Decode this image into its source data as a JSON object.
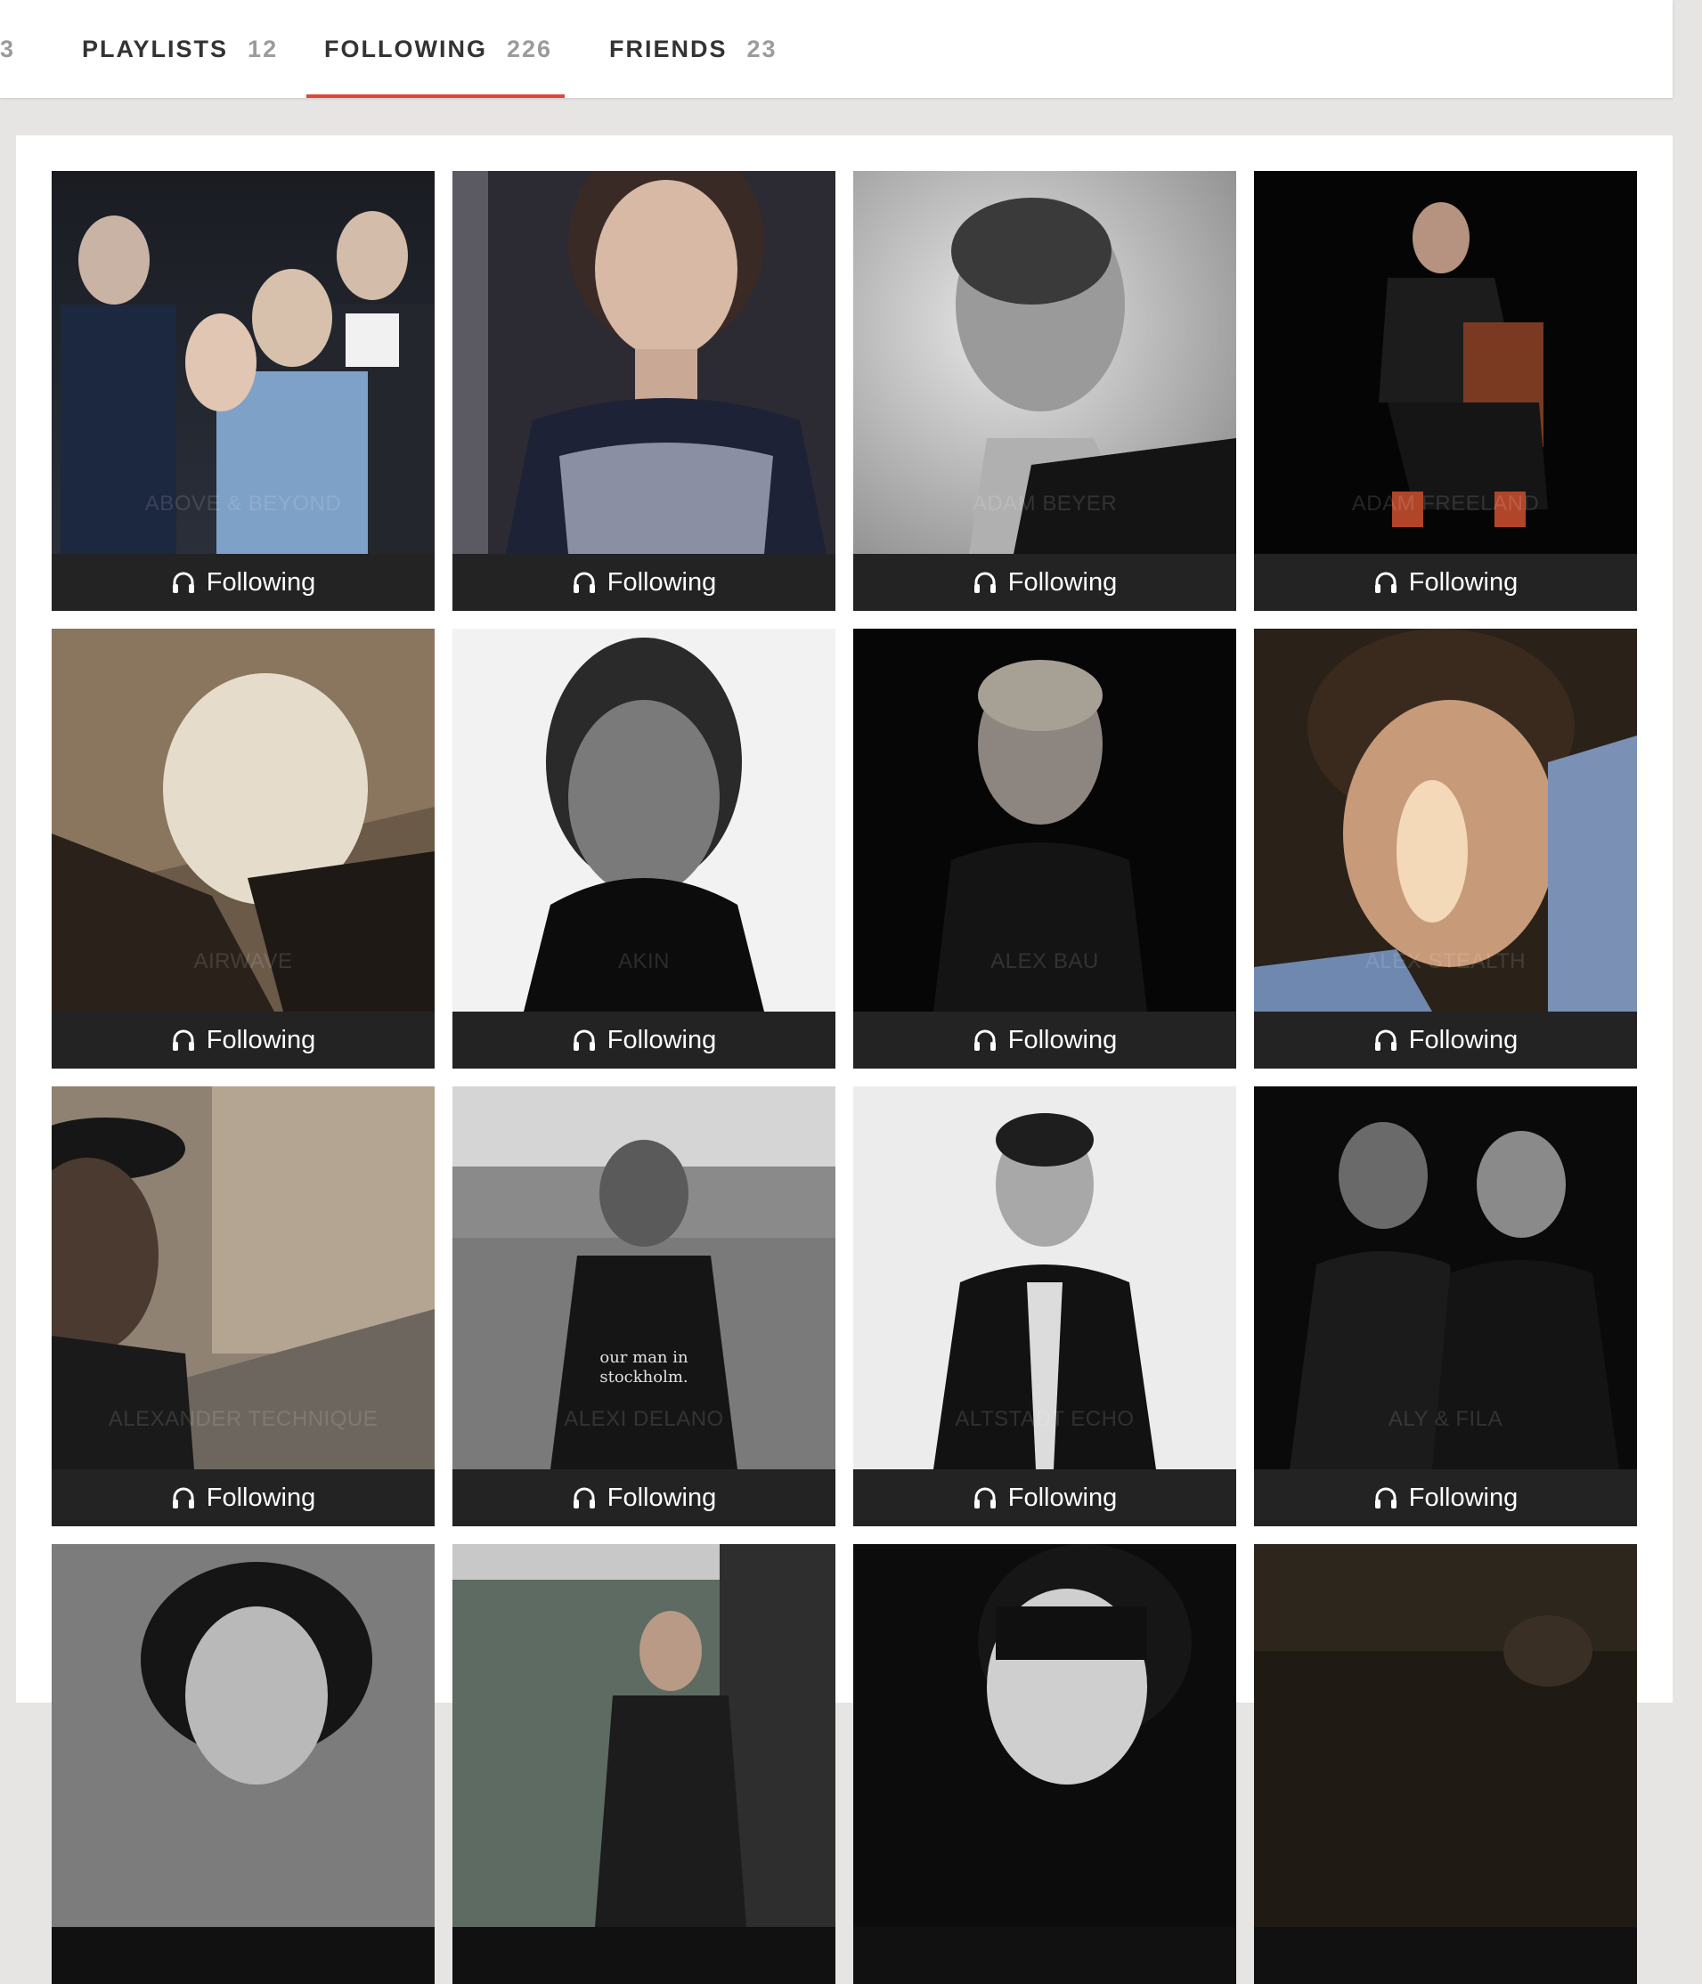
{
  "tabs": [
    {
      "label": "",
      "count": "3"
    },
    {
      "label": "PLAYLISTS",
      "count": "12"
    },
    {
      "label": "FOLLOWING",
      "count": "226"
    },
    {
      "label": "FRIENDS",
      "count": "23"
    }
  ],
  "active_tab": "FOLLOWING",
  "accent_color": "#e0473a",
  "follow_label": "Following",
  "follow_icon": "headphones-icon",
  "artists": [
    {
      "name": "ABOVE & BEYOND",
      "status": "Following"
    },
    {
      "name": "",
      "status": "Following"
    },
    {
      "name": "ADAM BEYER",
      "status": "Following"
    },
    {
      "name": "ADAM FREELAND",
      "status": "Following"
    },
    {
      "name": "AIRWAVE",
      "status": "Following"
    },
    {
      "name": "AKIN",
      "status": "Following"
    },
    {
      "name": "ALEX BAU",
      "status": "Following"
    },
    {
      "name": "ALEX STEALTH",
      "status": "Following"
    },
    {
      "name": "ALEXANDER TECHNIQUE",
      "status": "Following"
    },
    {
      "name": "ALEXI DELANO",
      "status": "Following"
    },
    {
      "name": "ALTSTADT ECHO",
      "status": "Following"
    },
    {
      "name": "ALY & FILA",
      "status": "Following"
    },
    {
      "name": "",
      "status": ""
    },
    {
      "name": "",
      "status": ""
    },
    {
      "name": "",
      "status": ""
    },
    {
      "name": "",
      "status": ""
    }
  ]
}
